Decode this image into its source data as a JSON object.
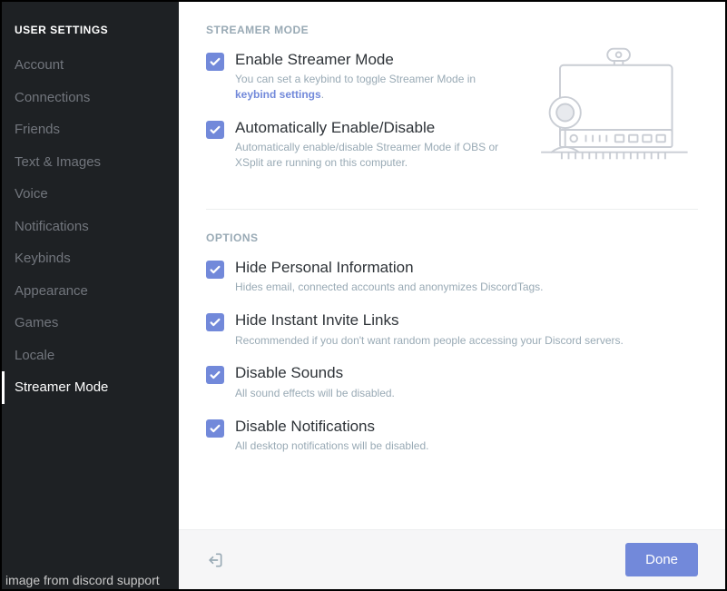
{
  "sidebar": {
    "header": "USER SETTINGS",
    "items": [
      {
        "label": "Account",
        "active": false
      },
      {
        "label": "Connections",
        "active": false
      },
      {
        "label": "Friends",
        "active": false
      },
      {
        "label": "Text & Images",
        "active": false
      },
      {
        "label": "Voice",
        "active": false
      },
      {
        "label": "Notifications",
        "active": false
      },
      {
        "label": "Keybinds",
        "active": false
      },
      {
        "label": "Appearance",
        "active": false
      },
      {
        "label": "Games",
        "active": false
      },
      {
        "label": "Locale",
        "active": false
      },
      {
        "label": "Streamer Mode",
        "active": true
      }
    ],
    "attribution": "image from discord support"
  },
  "sections": {
    "streamer_mode": {
      "title": "STREAMER MODE",
      "enable": {
        "label": "Enable Streamer Mode",
        "desc_pre": "You can set a keybind to toggle Streamer Mode in ",
        "desc_link": "keybind settings",
        "desc_post": "."
      },
      "auto": {
        "label": "Automatically Enable/Disable",
        "desc": "Automatically enable/disable Streamer Mode if OBS or XSplit are running on this computer."
      }
    },
    "options": {
      "title": "OPTIONS",
      "hide_personal": {
        "label": "Hide Personal Information",
        "desc": "Hides email, connected accounts and anonymizes DiscordTags."
      },
      "hide_invite": {
        "label": "Hide Instant Invite Links",
        "desc": "Recommended if you don't want random people accessing your Discord servers."
      },
      "disable_sounds": {
        "label": "Disable Sounds",
        "desc": "All sound effects will be disabled."
      },
      "disable_notifs": {
        "label": "Disable Notifications",
        "desc": "All desktop notifications will be disabled."
      }
    }
  },
  "footer": {
    "done": "Done"
  }
}
